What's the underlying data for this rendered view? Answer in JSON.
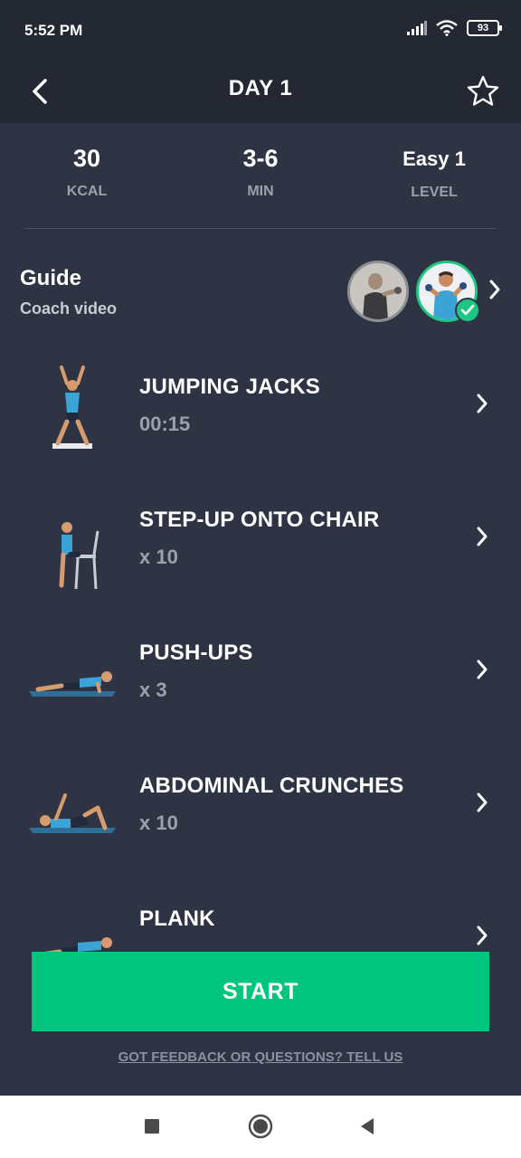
{
  "status": {
    "time": "5:52 PM",
    "battery": "93",
    "icons": [
      "signal-icon",
      "wifi-icon",
      "battery-icon"
    ]
  },
  "appbar": {
    "title": "DAY 1",
    "back_icon": "chevron-left-icon",
    "favorite_icon": "star-outline-icon"
  },
  "stats": [
    {
      "value": "30",
      "label": "KCAL"
    },
    {
      "value": "3-6",
      "label": "MIN"
    },
    {
      "value": "Easy 1",
      "label": "LEVEL"
    }
  ],
  "guide": {
    "title": "Guide",
    "subtitle": "Coach video"
  },
  "exercises": [
    {
      "name": "JUMPING JACKS",
      "detail": "00:15"
    },
    {
      "name": "STEP-UP ONTO CHAIR",
      "detail": "x 10"
    },
    {
      "name": "PUSH-UPS",
      "detail": "x 3"
    },
    {
      "name": "ABDOMINAL CRUNCHES",
      "detail": "x 10"
    },
    {
      "name": "PLANK",
      "detail": ""
    }
  ],
  "start_label": "START",
  "feedback_label": "GOT FEEDBACK OR QUESTIONS? TELL US",
  "colors": {
    "background": "#2e3444",
    "header": "#232833",
    "accent": "#00c57f",
    "muted_text": "#9aa0ad"
  },
  "nav": [
    "recents-square-icon",
    "home-circle-icon",
    "back-triangle-icon"
  ]
}
